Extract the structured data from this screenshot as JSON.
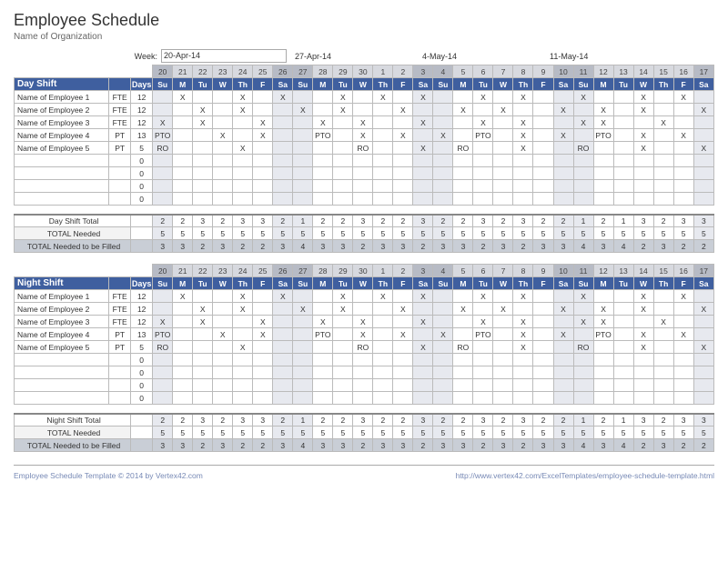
{
  "title": "Employee Schedule",
  "subtitle": "Name of Organization",
  "week_label": "Week:",
  "weeks": [
    "20-Apr-14",
    "27-Apr-14",
    "4-May-14",
    "11-May-14"
  ],
  "day_nums": [
    "20",
    "21",
    "22",
    "23",
    "24",
    "25",
    "26",
    "27",
    "28",
    "29",
    "30",
    "1",
    "2",
    "3",
    "4",
    "5",
    "6",
    "7",
    "8",
    "9",
    "10",
    "11",
    "12",
    "13",
    "14",
    "15",
    "16",
    "17"
  ],
  "dow": [
    "Su",
    "M",
    "Tu",
    "W",
    "Th",
    "F",
    "Sa",
    "Su",
    "M",
    "Tu",
    "W",
    "Th",
    "F",
    "Sa",
    "Su",
    "M",
    "Tu",
    "W",
    "Th",
    "F",
    "Sa",
    "Su",
    "M",
    "Tu",
    "W",
    "Th",
    "F",
    "Sa"
  ],
  "weekend_idx": [
    0,
    6,
    7,
    13,
    14,
    20,
    21,
    27
  ],
  "days_label": "Days",
  "sections": [
    {
      "name": "Day Shift",
      "employees": [
        {
          "n": "Name of Employee 1",
          "t": "FTE",
          "d": "12",
          "c": [
            "",
            "X",
            "",
            "",
            "X",
            "",
            "X",
            "",
            "",
            "X",
            "",
            "X",
            "",
            "X",
            "",
            "",
            "X",
            "",
            "X",
            "",
            "",
            "X",
            "",
            "",
            "X",
            "",
            "X",
            ""
          ]
        },
        {
          "n": "Name of Employee 2",
          "t": "FTE",
          "d": "12",
          "c": [
            "",
            "",
            "X",
            "",
            "X",
            "",
            "",
            "X",
            "",
            "X",
            "",
            "",
            "X",
            "",
            "",
            "X",
            "",
            "X",
            "",
            "",
            "X",
            "",
            "X",
            "",
            "X",
            "",
            "",
            "X"
          ]
        },
        {
          "n": "Name of Employee 3",
          "t": "FTE",
          "d": "12",
          "c": [
            "X",
            "",
            "X",
            "",
            "",
            "X",
            "",
            "",
            "X",
            "",
            "X",
            "",
            "",
            "X",
            "",
            "",
            "X",
            "",
            "X",
            "",
            "",
            "X",
            "X",
            "",
            "",
            "X",
            "",
            ""
          ]
        },
        {
          "n": "Name of Employee 4",
          "t": "PT",
          "d": "13",
          "c": [
            "PTO",
            "",
            "",
            "X",
            "",
            "X",
            "",
            "",
            "PTO",
            "",
            "X",
            "",
            "X",
            "",
            "X",
            "",
            "PTO",
            "",
            "X",
            "",
            "X",
            "",
            "PTO",
            "",
            "X",
            "",
            "X",
            ""
          ]
        },
        {
          "n": "Name of Employee 5",
          "t": "PT",
          "d": "5",
          "c": [
            "RO",
            "",
            "",
            "",
            "X",
            "",
            "",
            "",
            "",
            "",
            "RO",
            "",
            "",
            "X",
            "",
            "RO",
            "",
            "",
            "X",
            "",
            "",
            "RO",
            "",
            "",
            "X",
            "",
            "",
            "X"
          ]
        }
      ],
      "blank_rows": 4,
      "totals": [
        {
          "n": "Day Shift Total",
          "v": [
            "2",
            "2",
            "3",
            "2",
            "3",
            "3",
            "2",
            "1",
            "2",
            "2",
            "3",
            "2",
            "2",
            "3",
            "2",
            "2",
            "3",
            "2",
            "3",
            "2",
            "2",
            "1",
            "2",
            "1",
            "3",
            "2",
            "3",
            "3"
          ],
          "cls": "shift"
        },
        {
          "n": "TOTAL Needed",
          "v": [
            "5",
            "5",
            "5",
            "5",
            "5",
            "5",
            "5",
            "5",
            "5",
            "5",
            "5",
            "5",
            "5",
            "5",
            "5",
            "5",
            "5",
            "5",
            "5",
            "5",
            "5",
            "5",
            "5",
            "5",
            "5",
            "5",
            "5",
            "5"
          ],
          "cls": ""
        },
        {
          "n": "TOTAL Needed to be Filled",
          "v": [
            "3",
            "3",
            "2",
            "3",
            "2",
            "2",
            "3",
            "4",
            "3",
            "3",
            "2",
            "3",
            "3",
            "2",
            "3",
            "3",
            "2",
            "3",
            "2",
            "3",
            "3",
            "4",
            "3",
            "4",
            "2",
            "3",
            "2",
            "2"
          ],
          "cls": "fill"
        }
      ]
    },
    {
      "name": "Night Shift",
      "employees": [
        {
          "n": "Name of Employee 1",
          "t": "FTE",
          "d": "12",
          "c": [
            "",
            "X",
            "",
            "",
            "X",
            "",
            "X",
            "",
            "",
            "X",
            "",
            "X",
            "",
            "X",
            "",
            "",
            "X",
            "",
            "X",
            "",
            "",
            "X",
            "",
            "",
            "X",
            "",
            "X",
            ""
          ]
        },
        {
          "n": "Name of Employee 2",
          "t": "FTE",
          "d": "12",
          "c": [
            "",
            "",
            "X",
            "",
            "X",
            "",
            "",
            "X",
            "",
            "X",
            "",
            "",
            "X",
            "",
            "",
            "X",
            "",
            "X",
            "",
            "",
            "X",
            "",
            "X",
            "",
            "X",
            "",
            "",
            "X"
          ]
        },
        {
          "n": "Name of Employee 3",
          "t": "FTE",
          "d": "12",
          "c": [
            "X",
            "",
            "X",
            "",
            "",
            "X",
            "",
            "",
            "X",
            "",
            "X",
            "",
            "",
            "X",
            "",
            "",
            "X",
            "",
            "X",
            "",
            "",
            "X",
            "X",
            "",
            "",
            "X",
            "",
            ""
          ]
        },
        {
          "n": "Name of Employee 4",
          "t": "PT",
          "d": "13",
          "c": [
            "PTO",
            "",
            "",
            "X",
            "",
            "X",
            "",
            "",
            "PTO",
            "",
            "X",
            "",
            "X",
            "",
            "X",
            "",
            "PTO",
            "",
            "X",
            "",
            "X",
            "",
            "PTO",
            "",
            "X",
            "",
            "X",
            ""
          ]
        },
        {
          "n": "Name of Employee 5",
          "t": "PT",
          "d": "5",
          "c": [
            "RO",
            "",
            "",
            "",
            "X",
            "",
            "",
            "",
            "",
            "",
            "RO",
            "",
            "",
            "X",
            "",
            "RO",
            "",
            "",
            "X",
            "",
            "",
            "RO",
            "",
            "",
            "X",
            "",
            "",
            "X"
          ]
        }
      ],
      "blank_rows": 4,
      "totals": [
        {
          "n": "Night Shift Total",
          "v": [
            "2",
            "2",
            "3",
            "2",
            "3",
            "3",
            "2",
            "1",
            "2",
            "2",
            "3",
            "2",
            "2",
            "3",
            "2",
            "2",
            "3",
            "2",
            "3",
            "2",
            "2",
            "1",
            "2",
            "1",
            "3",
            "2",
            "3",
            "3"
          ],
          "cls": "shift"
        },
        {
          "n": "TOTAL Needed",
          "v": [
            "5",
            "5",
            "5",
            "5",
            "5",
            "5",
            "5",
            "5",
            "5",
            "5",
            "5",
            "5",
            "5",
            "5",
            "5",
            "5",
            "5",
            "5",
            "5",
            "5",
            "5",
            "5",
            "5",
            "5",
            "5",
            "5",
            "5",
            "5"
          ],
          "cls": ""
        },
        {
          "n": "TOTAL Needed to be Filled",
          "v": [
            "3",
            "3",
            "2",
            "3",
            "2",
            "2",
            "3",
            "4",
            "3",
            "3",
            "2",
            "3",
            "3",
            "2",
            "3",
            "3",
            "2",
            "3",
            "2",
            "3",
            "3",
            "4",
            "3",
            "4",
            "2",
            "3",
            "2",
            "2"
          ],
          "cls": "fill"
        }
      ]
    }
  ],
  "footer_left": "Employee Schedule Template © 2014 by Vertex42.com",
  "footer_right": "http://www.vertex42.com/ExcelTemplates/employee-schedule-template.html"
}
